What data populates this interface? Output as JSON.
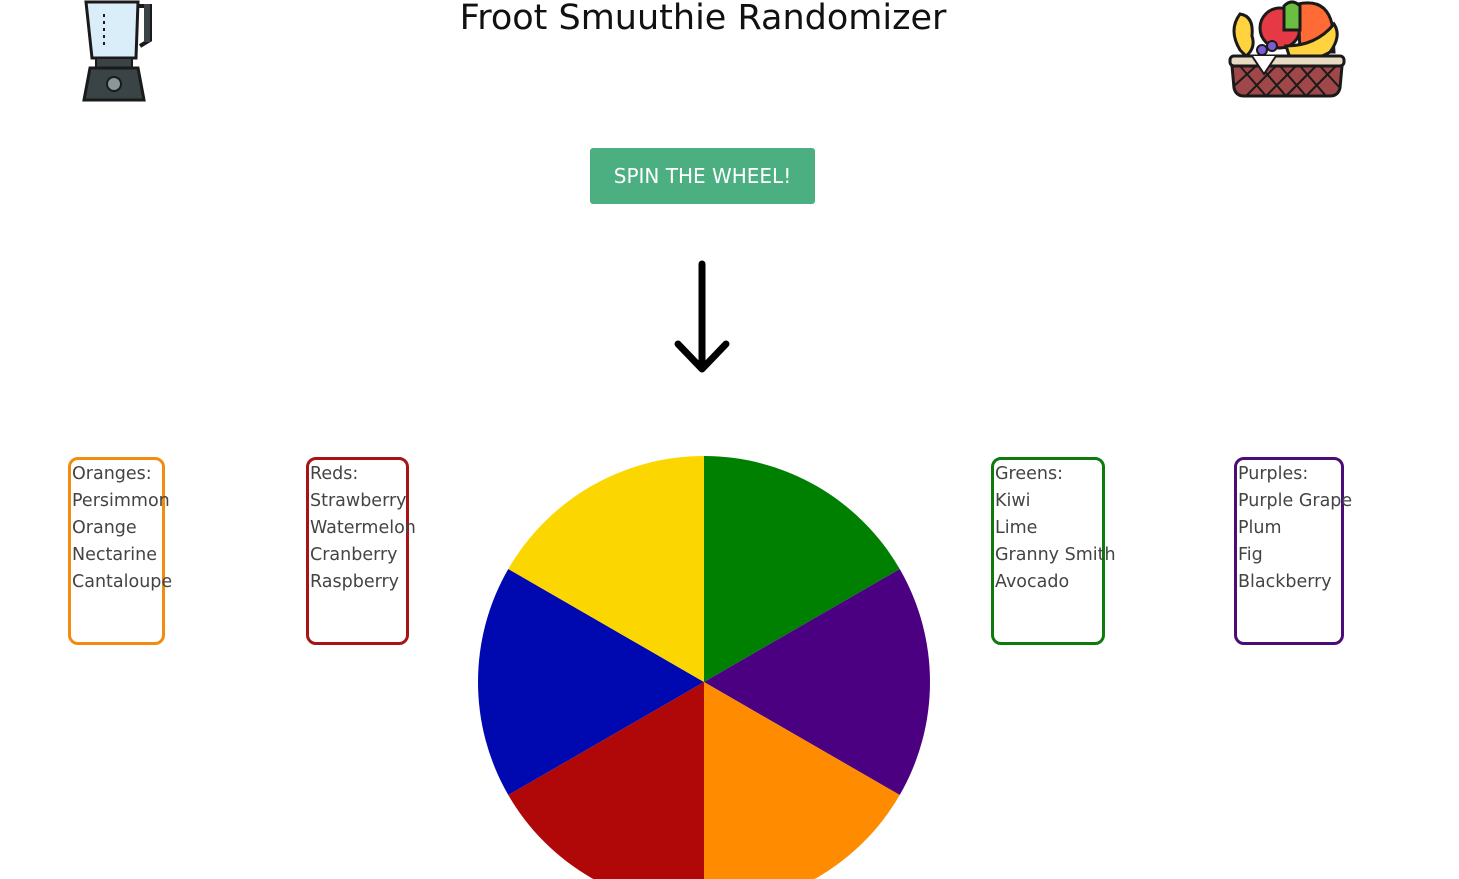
{
  "header": {
    "title": "Froot Smuuthie Randomizer",
    "left_icon": "blender-icon",
    "right_icon": "fruit-basket-icon"
  },
  "controls": {
    "spin_label": "SPIN THE WHEEL!",
    "pointer_icon": "down-arrow-icon"
  },
  "wheel": {
    "segments": [
      {
        "color": "#008000"
      },
      {
        "color": "#4b0082"
      },
      {
        "color": "#ff8c00"
      },
      {
        "color": "#b00808"
      },
      {
        "color": "#0008b0"
      },
      {
        "color": "#fcd600"
      }
    ]
  },
  "groups": [
    {
      "heading": "Oranges:",
      "color": "#f28c0f",
      "items": [
        "Persimmon",
        "Orange",
        "Nectarine",
        "Cantaloupe"
      ]
    },
    {
      "heading": "Reds:",
      "color": "#a81414",
      "items": [
        "Strawberry",
        "Watermelon",
        "Cranberry",
        "Raspberry"
      ]
    },
    {
      "heading": "Greens:",
      "color": "#0e7a0e",
      "items": [
        "Kiwi",
        "Lime",
        "Granny Smith",
        "Avocado"
      ]
    },
    {
      "heading": "Purples:",
      "color": "#4b0c7a",
      "items": [
        "Purple Grape",
        "Plum",
        "Fig",
        "Blackberry"
      ]
    }
  ],
  "colors": {
    "button_bg": "#4caf82",
    "button_text": "#ffffff"
  }
}
